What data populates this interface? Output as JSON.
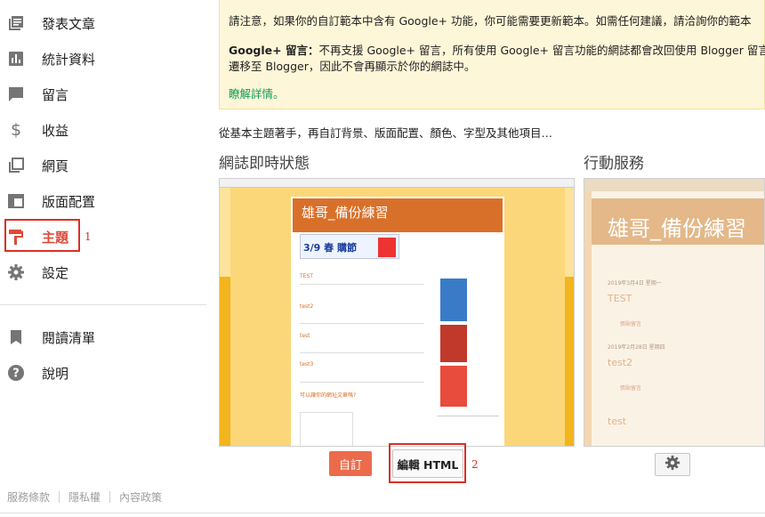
{
  "sidebar": {
    "items": [
      {
        "label": "發表文章",
        "icon": "posts-icon"
      },
      {
        "label": "統計資料",
        "icon": "stats-icon"
      },
      {
        "label": "留言",
        "icon": "comment-icon"
      },
      {
        "label": "收益",
        "icon": "dollar-icon"
      },
      {
        "label": "網頁",
        "icon": "pages-icon"
      },
      {
        "label": "版面配置",
        "icon": "layout-icon"
      },
      {
        "label": "主題",
        "icon": "theme-roller-icon"
      },
      {
        "label": "設定",
        "icon": "gear-icon"
      },
      {
        "label": "閱讀清單",
        "icon": "bookmark-icon"
      },
      {
        "label": "說明",
        "icon": "help-icon"
      }
    ],
    "annotation_1": "1"
  },
  "footer": {
    "links": [
      "服務條款",
      "隱私權",
      "內容政策"
    ]
  },
  "notice": {
    "line1": "請注意，如果你的自訂範本中含有 Google+ 功能，你可能需要更新範本。如需任何建議，請洽詢你的範本",
    "gplus_bold": "Google+ 留言：",
    "gplus_text": "不再支援 Google+ 留言，所有使用 Google+ 留言功能的網誌都會改回使用 Blogger 留言功",
    "line3": "遷移至 Blogger，因此不會再顯示於你的網誌中。",
    "learn_more": "瞭解詳情。"
  },
  "intro": "從基本主題著手，再自訂背景、版面配置、顏色、字型及其他項目…",
  "sections": {
    "live_title": "網誌即時狀態",
    "mobile_title": "行動服務"
  },
  "live_preview": {
    "blog_title": "雄哥_備份練習",
    "banner_text": "3/9 春 購節",
    "posts": [
      "TEST",
      "test2",
      "test",
      "test3"
    ],
    "post_link": "可以讓你的網址文章嗎?"
  },
  "mobile_preview": {
    "blog_title": "雄哥_備份練習",
    "date1": "2019年3月4日 星期一",
    "post1": "TEST",
    "date2": "2019年2月28日 星期四",
    "post2": "test2",
    "comment": "張貼留言",
    "post3": "test"
  },
  "buttons": {
    "customize": "自訂",
    "edit_html": "編輯 HTML",
    "annotation_2": "2"
  },
  "colors": {
    "active": "#dd4b39",
    "customize_button": "#ec6b4b",
    "notice_bg": "#fef6d8",
    "annotation": "#d93025",
    "preview_header": "#d9702a"
  }
}
